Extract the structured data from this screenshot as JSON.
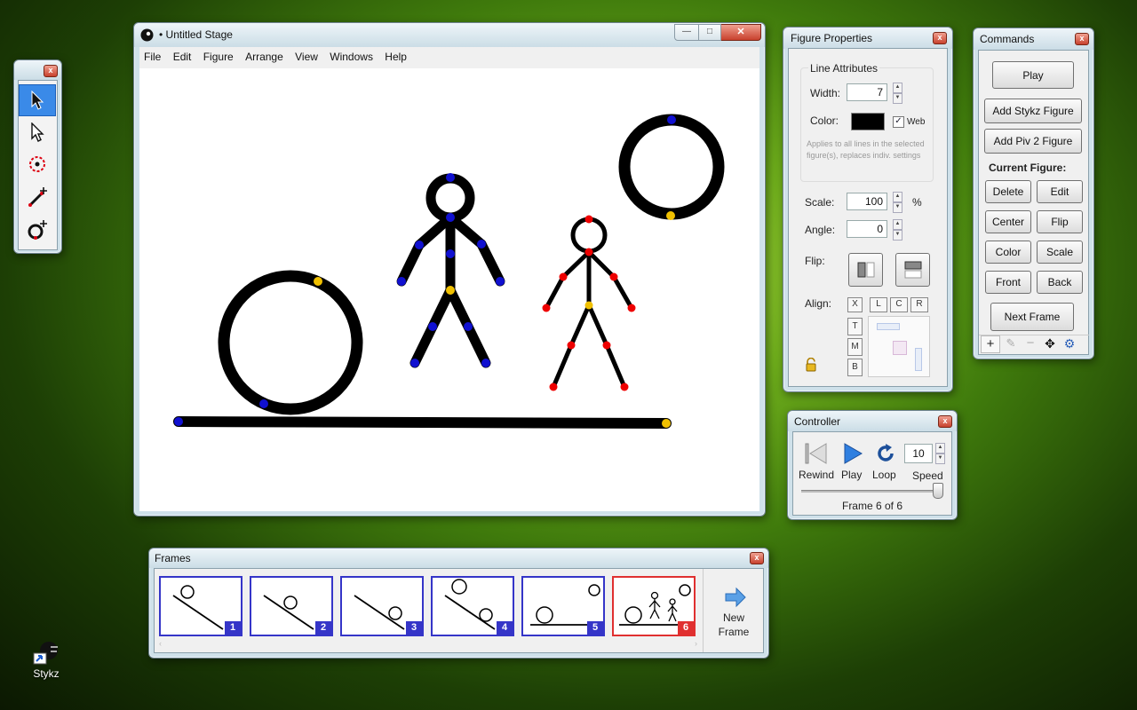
{
  "stage": {
    "title": "• Untitled Stage",
    "menus": [
      "File",
      "Edit",
      "Figure",
      "Arrange",
      "View",
      "Windows",
      "Help"
    ],
    "window_controls": [
      "—",
      "□",
      "✕"
    ]
  },
  "tools": {
    "items": [
      "select-arrow-icon",
      "direct-select-arrow-icon",
      "rotate-joint-icon",
      "add-line-icon",
      "add-circle-icon"
    ]
  },
  "figure_properties": {
    "title": "Figure Properties",
    "line_attributes_label": "Line Attributes",
    "width_label": "Width:",
    "width_value": "7",
    "color_label": "Color:",
    "color_value": "#000000",
    "web_label": "Web",
    "note": "Applies to all lines in the selected figure(s), replaces indiv. settings",
    "scale_label": "Scale:",
    "scale_value": "100",
    "scale_unit": "%",
    "angle_label": "Angle:",
    "angle_value": "0",
    "flip_label": "Flip:",
    "align_label": "Align:",
    "align_buttons": [
      "X",
      "L",
      "C",
      "R",
      "T",
      "M",
      "B"
    ]
  },
  "commands": {
    "title": "Commands",
    "play": "Play",
    "add_stykz": "Add Stykz Figure",
    "add_piv2": "Add Piv 2 Figure",
    "current_figure_label": "Current Figure:",
    "delete": "Delete",
    "edit": "Edit",
    "center": "Center",
    "flip": "Flip",
    "color": "Color",
    "scale": "Scale",
    "front": "Front",
    "back": "Back",
    "next_frame": "Next Frame",
    "bottom_icons": [
      "+",
      "✎",
      "−",
      "✥",
      "⚙"
    ]
  },
  "controller": {
    "title": "Controller",
    "rewind": "Rewind",
    "play": "Play",
    "loop": "Loop",
    "speed_label": "Speed",
    "speed_value": "10",
    "frame_status": "Frame 6 of 6"
  },
  "frames": {
    "title": "Frames",
    "numbers": [
      "1",
      "2",
      "3",
      "4",
      "5",
      "6"
    ],
    "selected": "6",
    "new_frame": "New\nFrame",
    "new_frame_line1": "New",
    "new_frame_line2": "Frame"
  },
  "desktop": {
    "icon_label": "Stykz"
  }
}
